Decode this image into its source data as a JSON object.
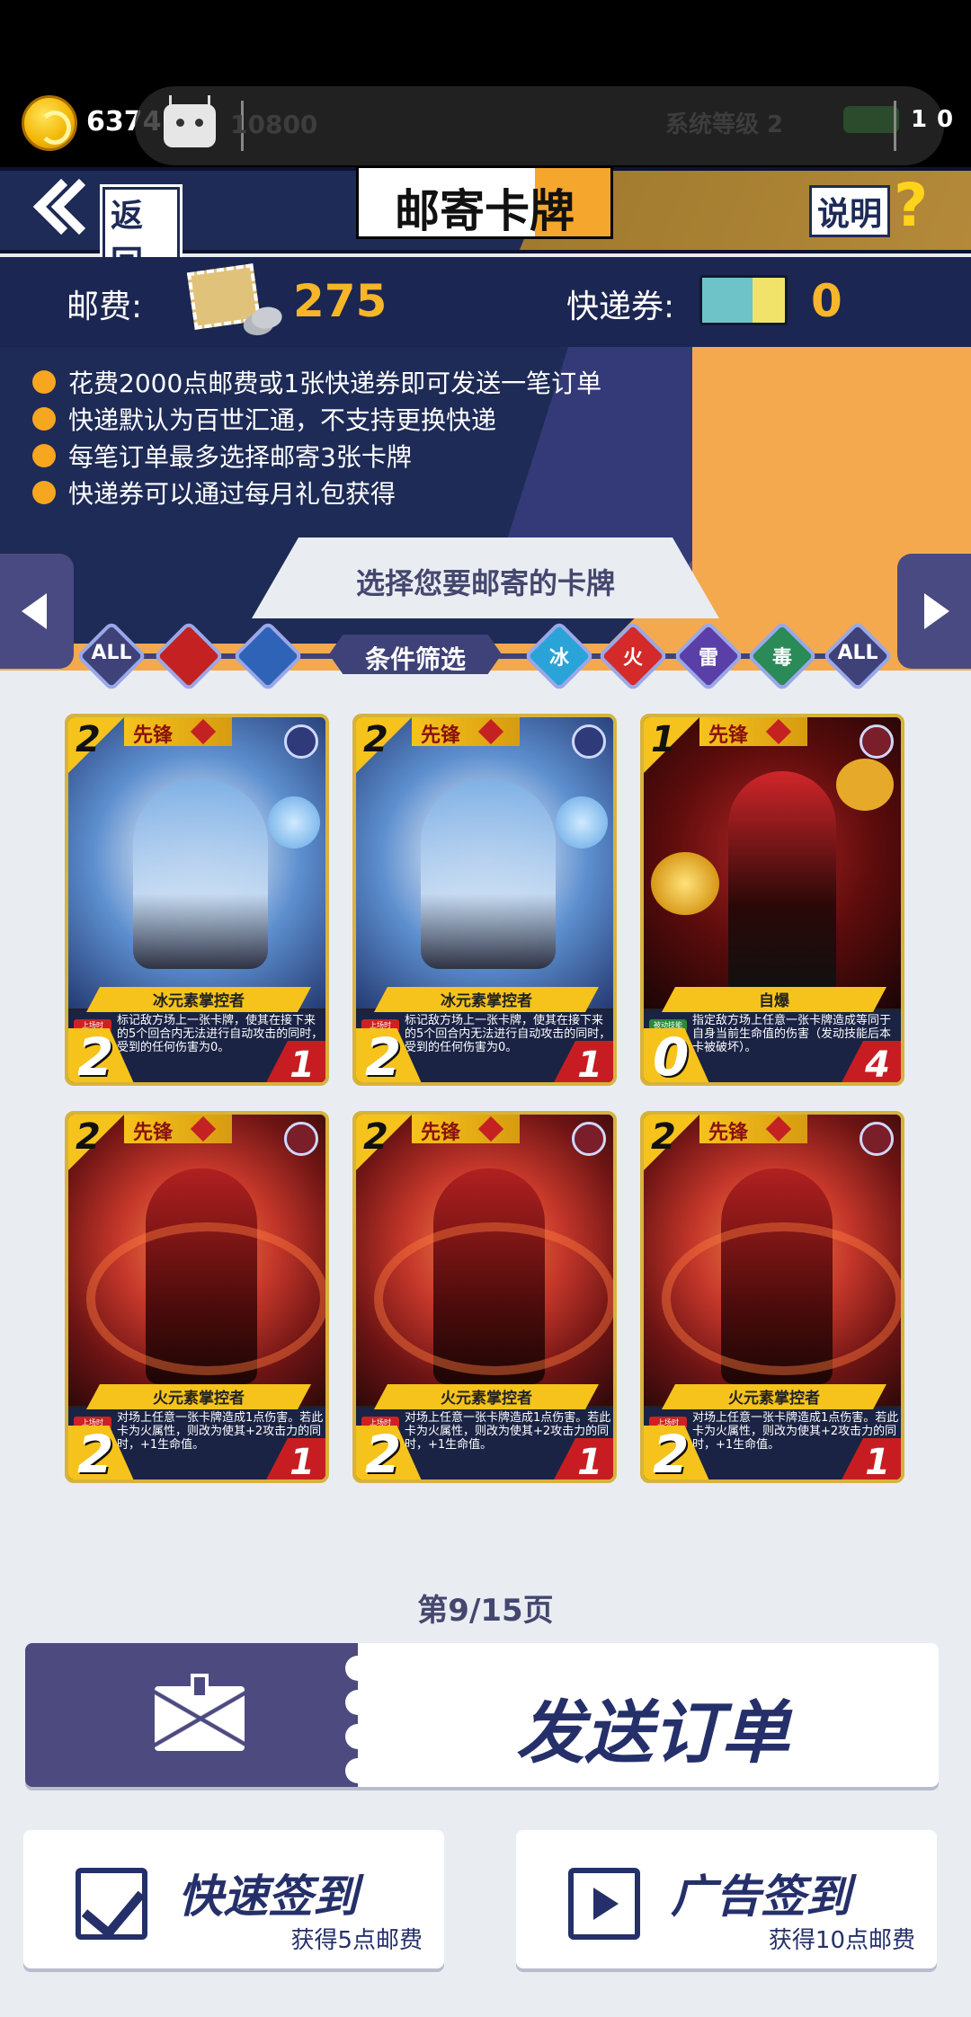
{
  "status_bar": {
    "coins": "6374",
    "ad_coins": "10800",
    "system_level": "系统等级 2",
    "battery_value": "1",
    "badge": "0"
  },
  "header": {
    "back_label": "返回",
    "title": "邮寄卡牌",
    "help_label": "说明",
    "help_icon": "?"
  },
  "fees": {
    "postage_label": "邮费:",
    "postage_value": "275",
    "voucher_label": "快递券:",
    "voucher_value": "0"
  },
  "rules": [
    "花费2000点邮费或1张快递券即可发送一笔订单",
    "快递默认为百世汇通，不支持更换快递",
    "每笔订单最多选择邮寄3张卡牌",
    "快递券可以通过每月礼包获得"
  ],
  "select_title": "选择您要邮寄的卡牌",
  "filters": {
    "left": [
      "ALL",
      "",
      ""
    ],
    "center": "条件筛选",
    "right": [
      "冰",
      "火",
      "雷",
      "毒",
      "ALL"
    ]
  },
  "colors": {
    "navy": "#1e2b57",
    "accent_orange": "#f4a94e",
    "purple": "#4d4a80",
    "gold": "#f6c31c"
  },
  "cards": [
    {
      "cost": "2",
      "class": "先锋",
      "name": "冰元素掌控者",
      "tag": "上场时",
      "desc": "标记敌方场上一张卡牌，使其在接下来的5个回合内无法进行自动攻击的同时，受到的任何伤害为0。",
      "attack": "2",
      "hp": "1",
      "element": "ice"
    },
    {
      "cost": "2",
      "class": "先锋",
      "name": "冰元素掌控者",
      "tag": "上场时",
      "desc": "标记敌方场上一张卡牌，使其在接下来的5个回合内无法进行自动攻击的同时，受到的任何伤害为0。",
      "attack": "2",
      "hp": "1",
      "element": "ice"
    },
    {
      "cost": "1",
      "class": "先锋",
      "name": "自爆",
      "tag": "被动技能",
      "desc": "指定敌方场上任意一张卡牌造成等同于自身当前生命值的伤害（发动技能后本卡被破坏）。",
      "attack": "0",
      "hp": "4",
      "element": "fire"
    },
    {
      "cost": "2",
      "class": "先锋",
      "name": "火元素掌控者",
      "tag": "上场时",
      "desc": "对场上任意一张卡牌造成1点伤害。若此卡为火属性，则改为使其+2攻击力的同时，+1生命值。",
      "attack": "2",
      "hp": "1",
      "element": "fire"
    },
    {
      "cost": "2",
      "class": "先锋",
      "name": "火元素掌控者",
      "tag": "上场时",
      "desc": "对场上任意一张卡牌造成1点伤害。若此卡为火属性，则改为使其+2攻击力的同时，+1生命值。",
      "attack": "2",
      "hp": "1",
      "element": "fire"
    },
    {
      "cost": "2",
      "class": "先锋",
      "name": "火元素掌控者",
      "tag": "上场时",
      "desc": "对场上任意一张卡牌造成1点伤害。若此卡为火属性，则改为使其+2攻击力的同时，+1生命值。",
      "attack": "2",
      "hp": "1",
      "element": "fire"
    }
  ],
  "pagination": "第9/15页",
  "send_button": "发送订单",
  "quick_sign": {
    "title": "快速签到",
    "subtitle": "获得5点邮费"
  },
  "ad_sign": {
    "title": "广告签到",
    "subtitle": "获得10点邮费"
  }
}
